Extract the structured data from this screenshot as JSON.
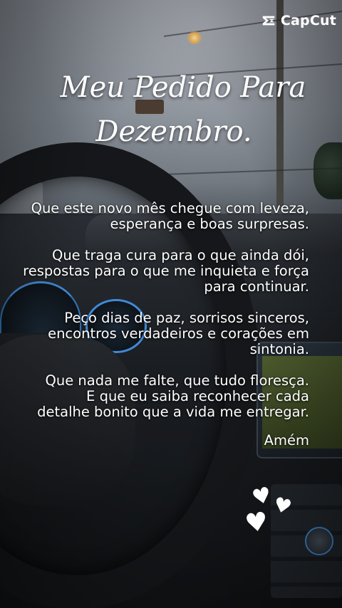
{
  "brand": {
    "name": "CapCut",
    "icon": "capcut-logo-icon"
  },
  "title": {
    "line1": "Meu Pedido Para",
    "line2": "Dezembro."
  },
  "poem": {
    "stanzas": [
      [
        "Que este novo mês chegue com leveza,",
        "esperança e boas surpresas."
      ],
      [
        "Que traga cura para o que ainda dói,",
        "respostas para o que me inquieta e força",
        "para continuar."
      ],
      [
        "Peço dias de paz, sorrisos sinceros,",
        "encontros verdadeiros e corações em",
        "sintonia."
      ],
      [
        "Que nada me falte, que tudo floresça.",
        "E que eu saiba reconhecer cada",
        "detalhe bonito que a vida me entregar."
      ]
    ],
    "closing": "Amém"
  },
  "decorations": {
    "hearts": 3,
    "heart_icon": "heart-icon",
    "text_color": "#ffffff"
  }
}
